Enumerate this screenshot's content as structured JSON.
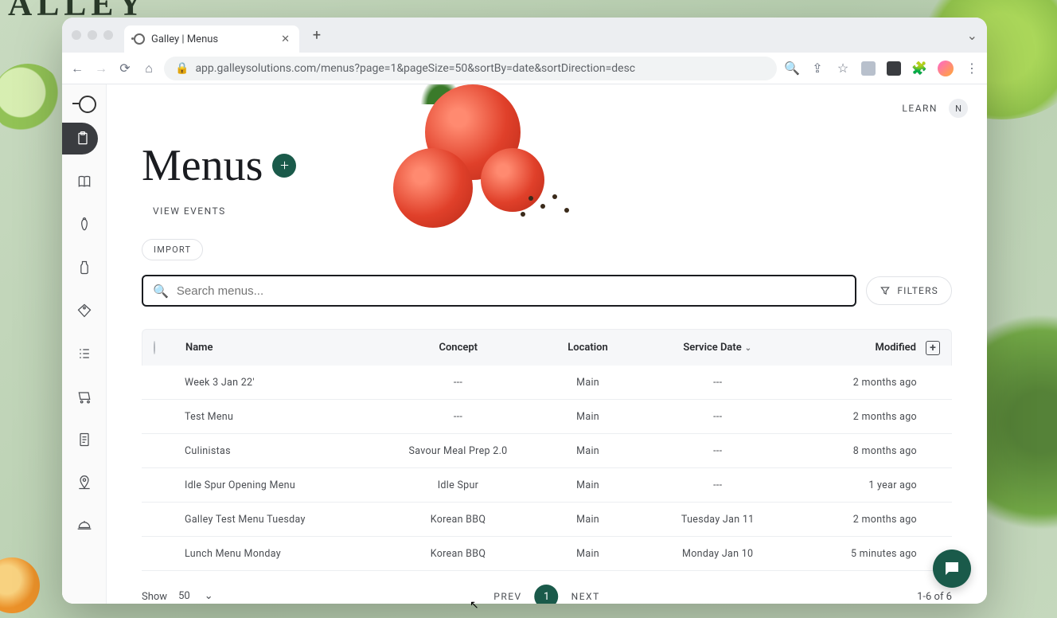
{
  "browser": {
    "tab_title": "Galley | Menus",
    "url": "app.galleysolutions.com/menus?page=1&pageSize=50&sortBy=date&sortDirection=desc"
  },
  "header": {
    "learn": "LEARN",
    "user_initial": "N"
  },
  "page": {
    "title": "Menus",
    "view_events": "VIEW EVENTS",
    "import": "IMPORT"
  },
  "search": {
    "placeholder": "Search menus...",
    "filters": "FILTERS"
  },
  "table": {
    "columns": {
      "name": "Name",
      "concept": "Concept",
      "location": "Location",
      "service_date": "Service Date",
      "modified": "Modified"
    },
    "rows": [
      {
        "name": "Week 3 Jan 22'",
        "concept": "---",
        "location": "Main",
        "service_date": "---",
        "modified": "2 months ago"
      },
      {
        "name": "Test Menu",
        "concept": "---",
        "location": "Main",
        "service_date": "---",
        "modified": "2 months ago"
      },
      {
        "name": "Culinistas",
        "concept": "Savour Meal Prep 2.0",
        "location": "Main",
        "service_date": "---",
        "modified": "8 months ago"
      },
      {
        "name": "Idle Spur Opening Menu",
        "concept": "Idle Spur",
        "location": "Main",
        "service_date": "---",
        "modified": "1 year ago"
      },
      {
        "name": "Galley Test Menu Tuesday",
        "concept": "Korean BBQ",
        "location": "Main",
        "service_date": "Tuesday Jan 11",
        "modified": "2 months ago"
      },
      {
        "name": "Lunch Menu Monday",
        "concept": "Korean BBQ",
        "location": "Main",
        "service_date": "Monday Jan 10",
        "modified": "5 minutes ago"
      }
    ]
  },
  "pagination": {
    "show_label": "Show",
    "page_size": "50",
    "prev": "PREV",
    "page": "1",
    "next": "NEXT",
    "range": "1-6 of 6"
  },
  "background_logo": "ALLEY"
}
